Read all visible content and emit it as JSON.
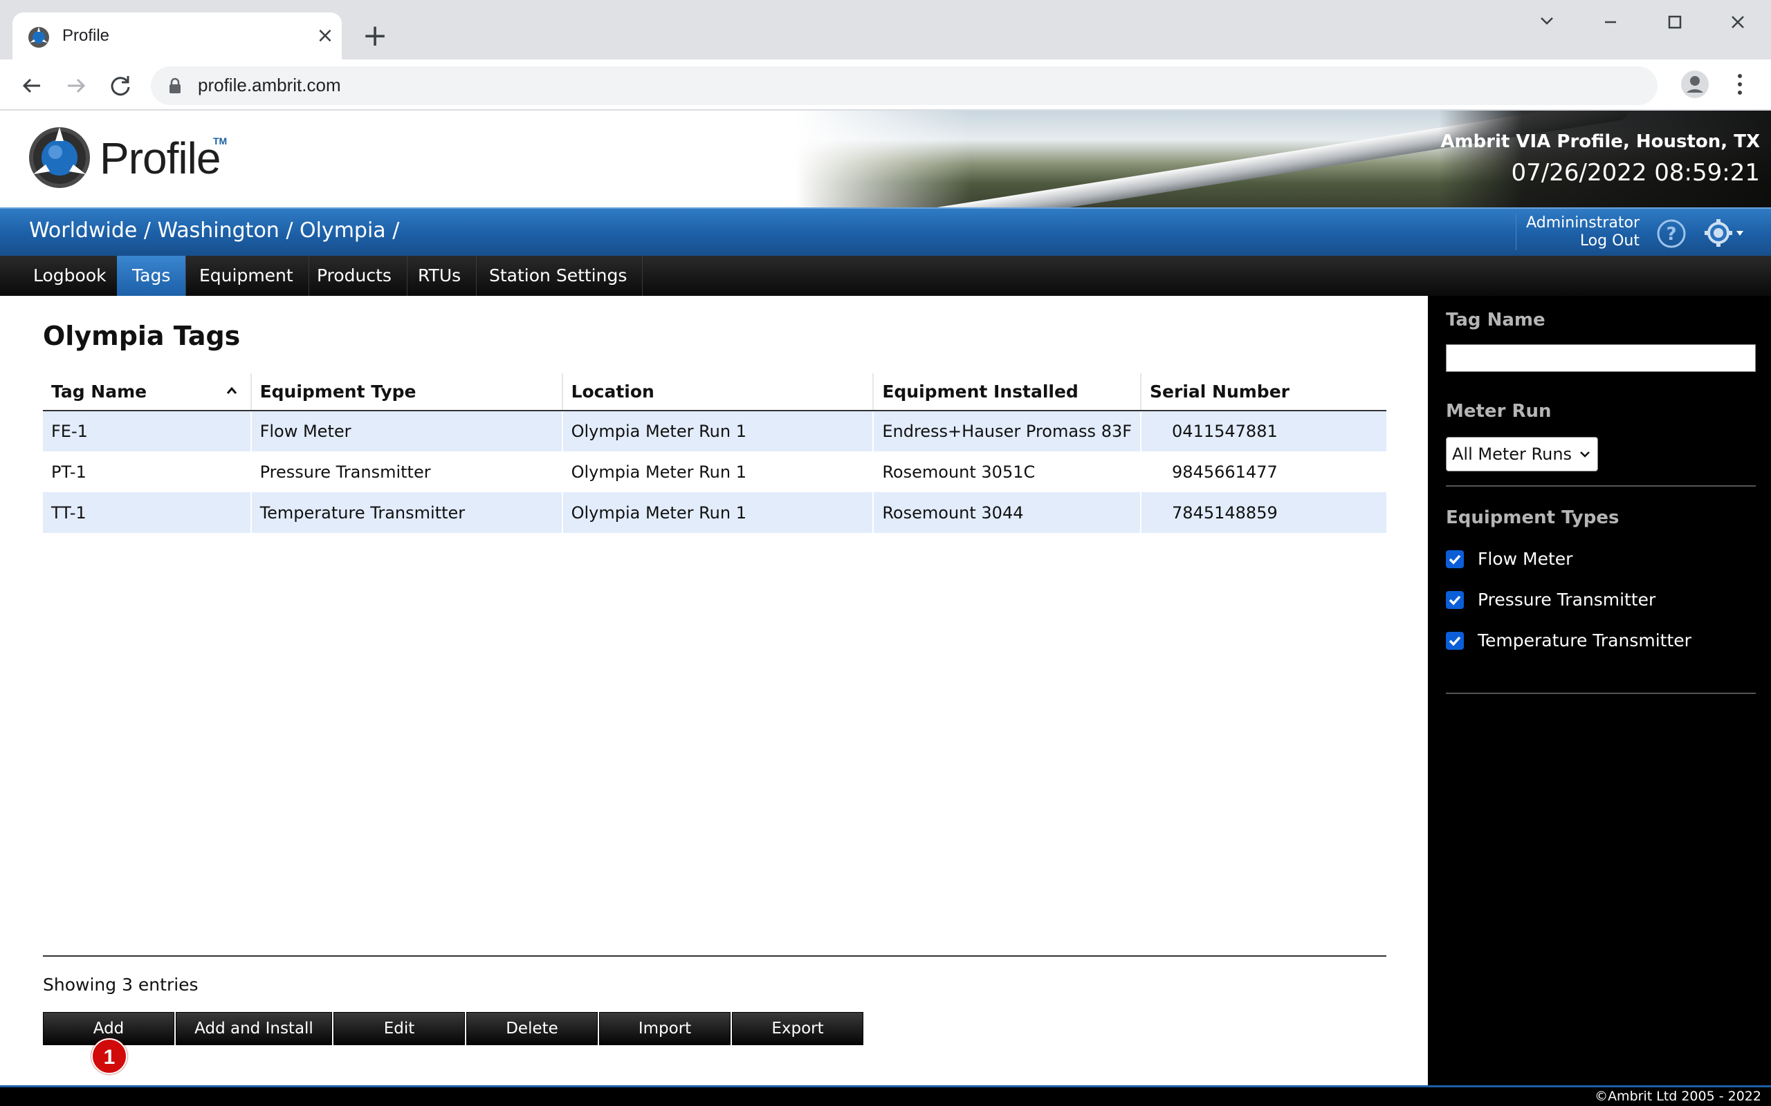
{
  "browser": {
    "tab_title": "Profile",
    "url": "profile.ambrit.com"
  },
  "header": {
    "logo_text": "Profile",
    "logo_tm": "TM",
    "site_name": "Ambrit VIA Profile, Houston, TX",
    "datetime": "07/26/2022 08:59:21"
  },
  "breadcrumb": "Worldwide / Washington / Olympia /",
  "user": {
    "name": "Admininstrator",
    "logout": "Log Out"
  },
  "nav": {
    "items": [
      "Logbook",
      "Tags",
      "Equipment",
      "Products",
      "RTUs",
      "Station Settings"
    ],
    "active": "Tags"
  },
  "main": {
    "title": "Olympia Tags",
    "columns": [
      "Tag Name",
      "Equipment Type",
      "Location",
      "Equipment Installed",
      "Serial Number"
    ],
    "rows": [
      [
        "FE-1",
        "Flow Meter",
        "Olympia Meter Run 1",
        "Endress+Hauser Promass 83F",
        "0411547881"
      ],
      [
        "PT-1",
        "Pressure Transmitter",
        "Olympia Meter Run 1",
        "Rosemount 3051C",
        "9845661477"
      ],
      [
        "TT-1",
        "Temperature Transmitter",
        "Olympia Meter Run 1",
        "Rosemount 3044",
        "7845148859"
      ]
    ],
    "entries_text": "Showing 3 entries",
    "actions": [
      "Add",
      "Add and Install",
      "Edit",
      "Delete",
      "Import",
      "Export"
    ],
    "badge": "1"
  },
  "filters": {
    "tag_name_label": "Tag Name",
    "tag_name_value": "",
    "meter_run_label": "Meter Run",
    "meter_run_selected": "All Meter Runs",
    "equipment_types_label": "Equipment Types",
    "equipment_types": [
      "Flow Meter",
      "Pressure Transmitter",
      "Temperature Transmitter"
    ]
  },
  "footer": {
    "copyright": "©Ambrit Ltd 2005 - 2022"
  },
  "colors": {
    "accent_blue": "#1c5fa6",
    "row_highlight": "#e2ecfb",
    "badge_red": "#d10a0a"
  }
}
